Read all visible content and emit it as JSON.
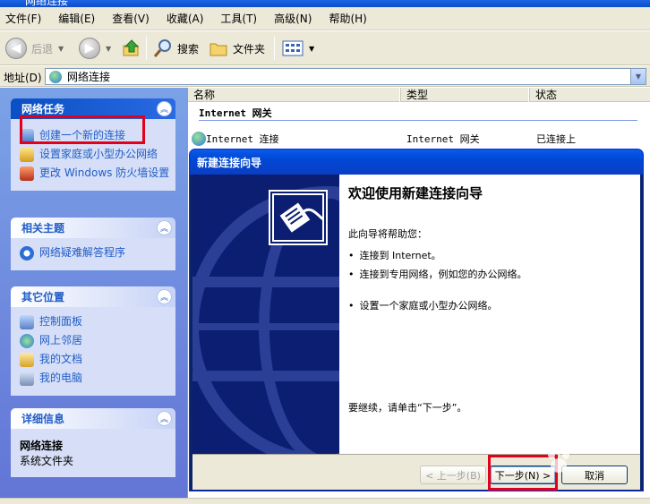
{
  "window": {
    "title": "网络连接"
  },
  "menu": [
    "文件(F)",
    "编辑(E)",
    "查看(V)",
    "收藏(A)",
    "工具(T)",
    "高级(N)",
    "帮助(H)"
  ],
  "toolbar": {
    "back": "后退",
    "search": "搜索",
    "folders": "文件夹"
  },
  "address": {
    "label": "地址(D)",
    "value": "网络连接"
  },
  "left_panels": {
    "tasks": {
      "title": "网络任务",
      "items": [
        "创建一个新的连接",
        "设置家庭或小型办公网络",
        "更改 Windows 防火墙设置"
      ]
    },
    "related": {
      "title": "相关主题",
      "items": [
        "网络疑难解答程序"
      ]
    },
    "other": {
      "title": "其它位置",
      "items": [
        "控制面板",
        "网上邻居",
        "我的文档",
        "我的电脑"
      ]
    },
    "details": {
      "title": "详细信息",
      "name": "网络连接",
      "type": "系统文件夹"
    }
  },
  "list": {
    "columns": [
      "名称",
      "类型",
      "状态"
    ],
    "group": "Internet 网关",
    "rows": [
      {
        "name": "Internet 连接",
        "type": "Internet 网关",
        "status": "已连接上"
      }
    ]
  },
  "wizard": {
    "title": "新建连接向导",
    "heading": "欢迎使用新建连接向导",
    "intro": "此向导将帮助您：",
    "bullets": [
      "连接到 Internet。",
      "连接到专用网络，例如您的办公网络。",
      "设置一个家庭或小型办公网络。"
    ],
    "continue": "要继续，请单击“下一步”。",
    "buttons": {
      "back": "< 上一步(B)",
      "next": "下一步(N) >",
      "cancel": "取消"
    }
  },
  "watermark": "Baidu 经验",
  "colors": {
    "xp_blue": "#0a5be8",
    "panel_link": "#215dc6",
    "highlight_red": "#e3001b"
  }
}
